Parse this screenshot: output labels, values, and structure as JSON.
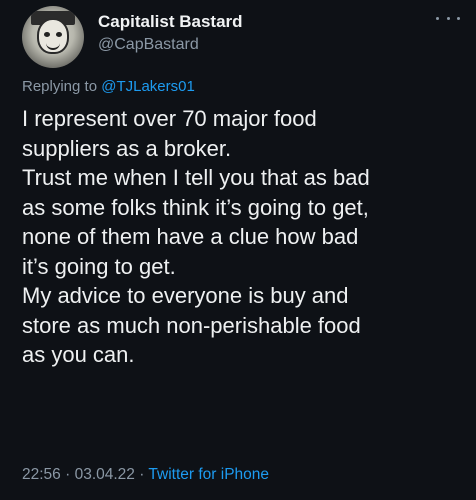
{
  "author": {
    "name": "Capitalist Bastard",
    "handle": "@CapBastard",
    "avatar_icon": "cartoon-face-avatar"
  },
  "reply": {
    "prefix": "Replying to ",
    "mention": "@TJLakers01"
  },
  "tweet": {
    "lines": [
      "I represent over 70 major food",
      "suppliers as a broker.",
      "Trust me when I tell you that as bad",
      "as some folks think it’s going to get,",
      "none of them have a clue how bad",
      "it’s going to get.",
      "My advice to everyone is buy and",
      "store as much non-perishable food",
      "as you can."
    ]
  },
  "footer": {
    "time": "22:56",
    "separator1": " · ",
    "date": "03.04.22",
    "separator2": " · ",
    "app": "Twitter for iPhone"
  },
  "colors": {
    "background": "#0e1116",
    "text": "#e7e9ea",
    "muted": "#8b98a5",
    "link": "#1d9bf0"
  }
}
